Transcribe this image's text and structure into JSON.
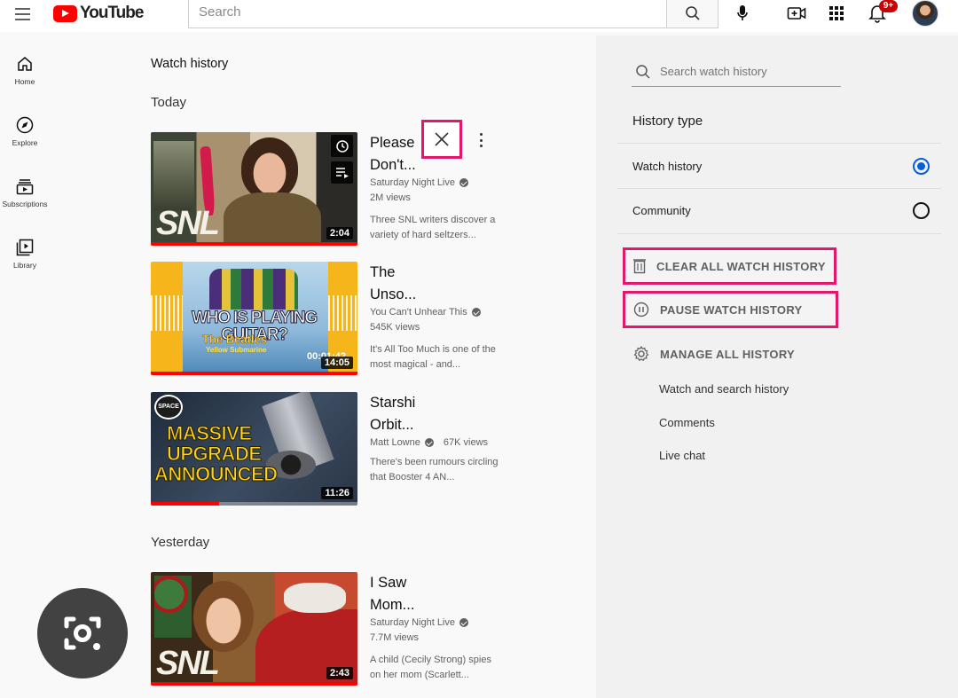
{
  "header": {
    "logo_text": "YouTube",
    "search_placeholder": "Search",
    "notifications_badge": "9+"
  },
  "mini_nav": [
    {
      "label": "Home",
      "icon": "home-icon"
    },
    {
      "label": "Explore",
      "icon": "compass-icon"
    },
    {
      "label": "Subscriptions",
      "icon": "subscriptions-icon"
    },
    {
      "label": "Library",
      "icon": "library-icon"
    }
  ],
  "main": {
    "page_title": "Watch history",
    "sections": {
      "today": "Today",
      "yesterday": "Yesterday"
    },
    "videos": [
      {
        "title": "Please Don't...",
        "channel": "Saturday Night Live",
        "views": "2M views",
        "description": "Three SNL writers discover a variety of hard seltzers...",
        "duration": "2:04",
        "progress": 1.0
      },
      {
        "title": "The Unso...",
        "channel": "You Can't Unhear This",
        "views": "545K views",
        "description": "It's All Too Much is one of the most magical - and...",
        "duration": "14:05",
        "progress": 1.0
      },
      {
        "title": "Starshi Orbit...",
        "channel": "Matt Lowne",
        "views": "67K views",
        "description": "There's been rumours circling that Booster 4 AN...",
        "duration": "11:26",
        "progress": 0.33
      },
      {
        "title": "I Saw Mom...",
        "channel": "Saturday Night Live",
        "views": "7.7M views",
        "description": "A child (Cecily Strong) spies on her mom (Scarlett...",
        "duration": "2:43",
        "progress": 1.0
      }
    ],
    "thumb_texts": {
      "snl": "SNL",
      "beatles_main": "WHO IS PLAYING GUITAR?",
      "beatles_sub": "The Beatles",
      "beatles_sub2": "Yellow Submarine",
      "beatles_time": "00:01:42",
      "space_badge": "SPACE",
      "space_line1": "MASSIVE",
      "space_line2": "UPGRADE",
      "space_line3": "ANNOUNCED"
    }
  },
  "panel": {
    "search_placeholder": "Search watch history",
    "history_type_title": "History type",
    "options": [
      {
        "label": "Watch history",
        "selected": true
      },
      {
        "label": "Community",
        "selected": false
      }
    ],
    "actions": {
      "clear": "CLEAR ALL WATCH HISTORY",
      "pause": "PAUSE WATCH HISTORY",
      "manage": "MANAGE ALL HISTORY"
    },
    "sublinks": [
      "Watch and search history",
      "Comments",
      "Live chat"
    ]
  },
  "colors": {
    "brand_red": "#ff0000",
    "highlight": "#e5176d",
    "radio_selected": "#065fd4"
  }
}
